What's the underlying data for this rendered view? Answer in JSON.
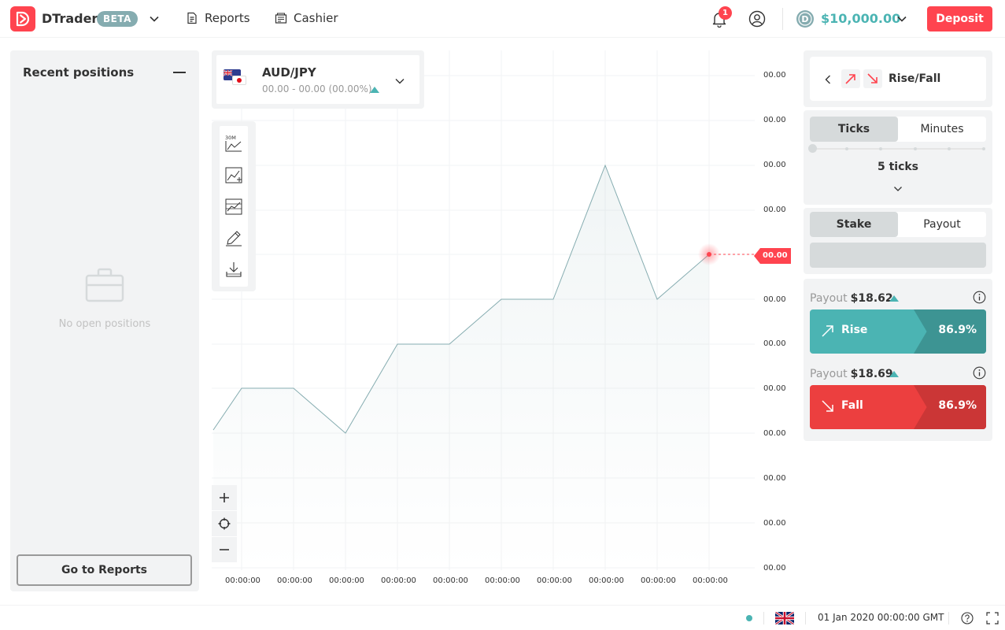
{
  "header": {
    "brand": "DTrader",
    "beta": "BETA",
    "nav": [
      {
        "label": "Reports",
        "icon": "report-icon"
      },
      {
        "label": "Cashier",
        "icon": "cashier-icon"
      }
    ],
    "notification_count": "1",
    "balance": "$10,000.00",
    "deposit_label": "Deposit"
  },
  "positions": {
    "title": "Recent positions",
    "empty_text": "No open positions",
    "go_reports_label": "Go to Reports"
  },
  "symbol": {
    "name": "AUD/JPY",
    "quote": "00.00 - 00.00 (00.00%)"
  },
  "chart": {
    "current_price_label": "00.00",
    "price_labels": [
      "00.00",
      "00.00",
      "00.00",
      "00.00",
      "00.00",
      "00.00",
      "00.00",
      "00.00",
      "00.00",
      "00.00",
      "00.00",
      "00.00"
    ],
    "time_labels": [
      "00:00:00",
      "00:00:00",
      "00:00:00",
      "00:00:00",
      "00:00:00",
      "00:00:00",
      "00:00:00",
      "00:00:00",
      "00:00:00",
      "00:00:00"
    ],
    "line_color": "#85acb0",
    "marker_color": "#ff444f"
  },
  "trade": {
    "contract_type": "Rise/Fall",
    "duration_tabs": [
      {
        "label": "Ticks",
        "active": true
      },
      {
        "label": "Minutes",
        "active": false
      }
    ],
    "duration_value": "5 ticks",
    "amount_tabs": [
      {
        "label": "Stake",
        "active": true
      },
      {
        "label": "Payout",
        "active": false
      }
    ],
    "rise": {
      "payout_label": "Payout",
      "payout_value": "$18.62",
      "label": "Rise",
      "percent": "86.9%",
      "color": "#4bb4b3"
    },
    "fall": {
      "payout_label": "Payout",
      "payout_value": "$18.69",
      "label": "Fall",
      "percent": "86.9%",
      "color": "#ec3f3f"
    }
  },
  "footer": {
    "server_time": "01 Jan 2020 00:00:00 GMT"
  }
}
